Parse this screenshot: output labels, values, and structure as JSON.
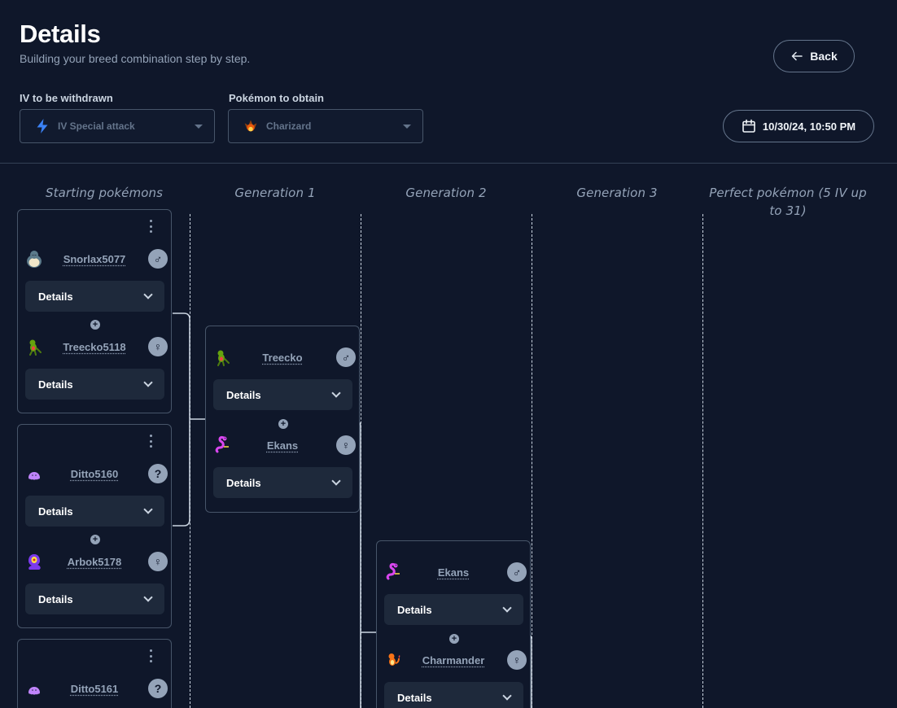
{
  "header": {
    "title": "Details",
    "subtitle": "Building your breed combination step by step.",
    "back_label": "Back"
  },
  "filters": {
    "iv_label": "IV to be withdrawn",
    "iv_value": "IV Special attack",
    "pokemon_label": "Pokémon to obtain",
    "pokemon_value": "Charizard"
  },
  "date": "10/30/24, 10:50 PM",
  "columns": [
    "Starting pokémons",
    "Generation 1",
    "Generation 2",
    "Generation 3",
    "Perfect pokémon (5 IV up to 31)"
  ],
  "details_label": "Details",
  "plus_symbol": "+",
  "kebab_icon": "more-vertical-icon",
  "colors": {
    "background": "#0f172a",
    "card_border": "#475569",
    "details_bg": "#1e293b",
    "gender_badge": "#94a3b8"
  },
  "cards": [
    {
      "id": "start-1",
      "pokemon": [
        {
          "name": "Snorlax5077",
          "gender": "♂",
          "sprite": "snorlax-icon"
        },
        {
          "name": "Treecko5118",
          "gender": "♀",
          "sprite": "treecko-icon"
        }
      ]
    },
    {
      "id": "start-2",
      "pokemon": [
        {
          "name": "Ditto5160",
          "gender": "?",
          "sprite": "ditto-icon"
        },
        {
          "name": "Arbok5178",
          "gender": "♀",
          "sprite": "arbok-icon"
        }
      ]
    },
    {
      "id": "start-3",
      "pokemon": [
        {
          "name": "Ditto5161",
          "gender": "?",
          "sprite": "ditto-icon"
        }
      ]
    },
    {
      "id": "gen1-1",
      "pokemon": [
        {
          "name": "Treecko",
          "gender": "♂",
          "sprite": "treecko-icon"
        },
        {
          "name": "Ekans",
          "gender": "♀",
          "sprite": "ekans-icon"
        }
      ]
    },
    {
      "id": "gen2-1",
      "pokemon": [
        {
          "name": "Ekans",
          "gender": "♂",
          "sprite": "ekans-icon"
        },
        {
          "name": "Charmander",
          "gender": "♀",
          "sprite": "charmander-icon"
        }
      ]
    }
  ]
}
